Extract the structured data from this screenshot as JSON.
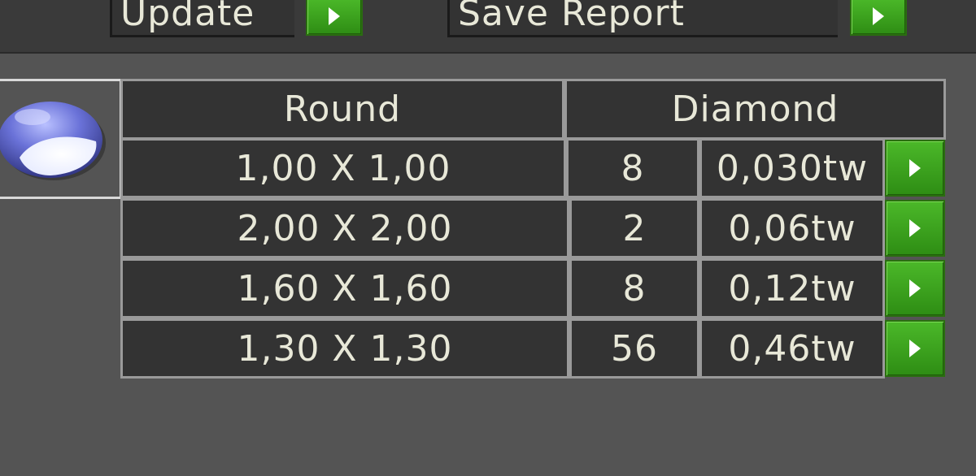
{
  "toolbar": {
    "update_label": "Update",
    "save_report_label": "Save Report"
  },
  "table": {
    "header": {
      "shape": "Round",
      "type": "Diamond"
    },
    "rows": [
      {
        "size": "1,00 X 1,00",
        "count": "8",
        "weight": "0,030tw"
      },
      {
        "size": "2,00 X 2,00",
        "count": "2",
        "weight": "0,06tw"
      },
      {
        "size": "1,60 X 1,60",
        "count": "8",
        "weight": "0,12tw"
      },
      {
        "size": "1,30 X 1,30",
        "count": "56",
        "weight": "0,46tw"
      }
    ]
  },
  "icons": {
    "gem": "round-gem-icon",
    "row_button": "play-arrow-icon"
  },
  "colors": {
    "background": "#545454",
    "cell": "#333333",
    "button_green": "#3aa21e",
    "text": "#e8e8d8"
  }
}
